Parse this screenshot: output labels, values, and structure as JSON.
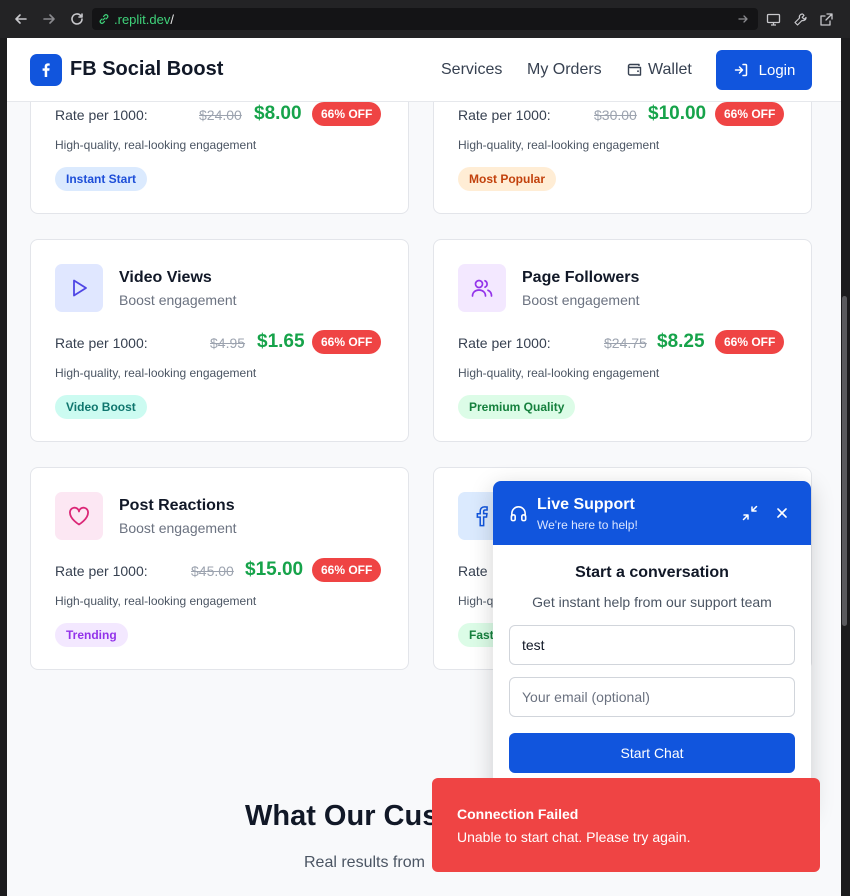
{
  "browser": {
    "url_host": ".replit.dev",
    "url_path": "/"
  },
  "header": {
    "brand": "FB Social Boost",
    "nav": [
      "Services",
      "My Orders",
      "Wallet"
    ],
    "login": "Login"
  },
  "cards": [
    {
      "rate_label": "Rate per 1000:",
      "old_price": "$24.00",
      "new_price": "$8.00",
      "discount": "66% OFF",
      "desc": "High-quality, real-looking engagement",
      "tag": "Instant Start",
      "tag_color": "#1d4ed8"
    },
    {
      "rate_label": "Rate per 1000:",
      "old_price": "$30.00",
      "new_price": "$10.00",
      "discount": "66% OFF",
      "desc": "High-quality, real-looking engagement",
      "tag": "Most Popular",
      "tag_color": "#c2410c"
    },
    {
      "title": "Video Views",
      "subtitle": "Boost engagement",
      "icon": "play-icon",
      "rate_label": "Rate per 1000:",
      "old_price": "$4.95",
      "new_price": "$1.65",
      "discount": "66% OFF",
      "desc": "High-quality, real-looking engagement",
      "tag": "Video Boost",
      "tag_color": "#0f766e"
    },
    {
      "title": "Page Followers",
      "subtitle": "Boost engagement",
      "icon": "users-icon",
      "rate_label": "Rate per 1000:",
      "old_price": "$24.75",
      "new_price": "$8.25",
      "discount": "66% OFF",
      "desc": "High-quality, real-looking engagement",
      "tag": "Premium Quality",
      "tag_color": "#15803d"
    },
    {
      "title": "Post Reactions",
      "subtitle": "Boost engagement",
      "icon": "heart-icon",
      "rate_label": "Rate per 1000:",
      "old_price": "$45.00",
      "new_price": "$15.00",
      "discount": "66% OFF",
      "desc": "High-quality, real-looking engagement",
      "tag": "Trending",
      "tag_color": "#9333ea"
    },
    {
      "icon": "facebook-icon",
      "rate_label": "Rate",
      "desc": "High-q",
      "tag": "Fast"
    }
  ],
  "section": {
    "title": "What Our Cus",
    "subtitle": "Real results from"
  },
  "chat": {
    "title": "Live Support",
    "subtitle": "We're here to help!",
    "heading": "Start a conversation",
    "text": "Get instant help from our support team",
    "name_value": "test",
    "email_placeholder": "Your email (optional)",
    "button": "Start Chat"
  },
  "toast": {
    "title": "Connection Failed",
    "message": "Unable to start chat. Please try again."
  },
  "colors": {
    "primary": "#1155dd",
    "price_green": "#16a34a",
    "discount_red": "#ef4444"
  }
}
